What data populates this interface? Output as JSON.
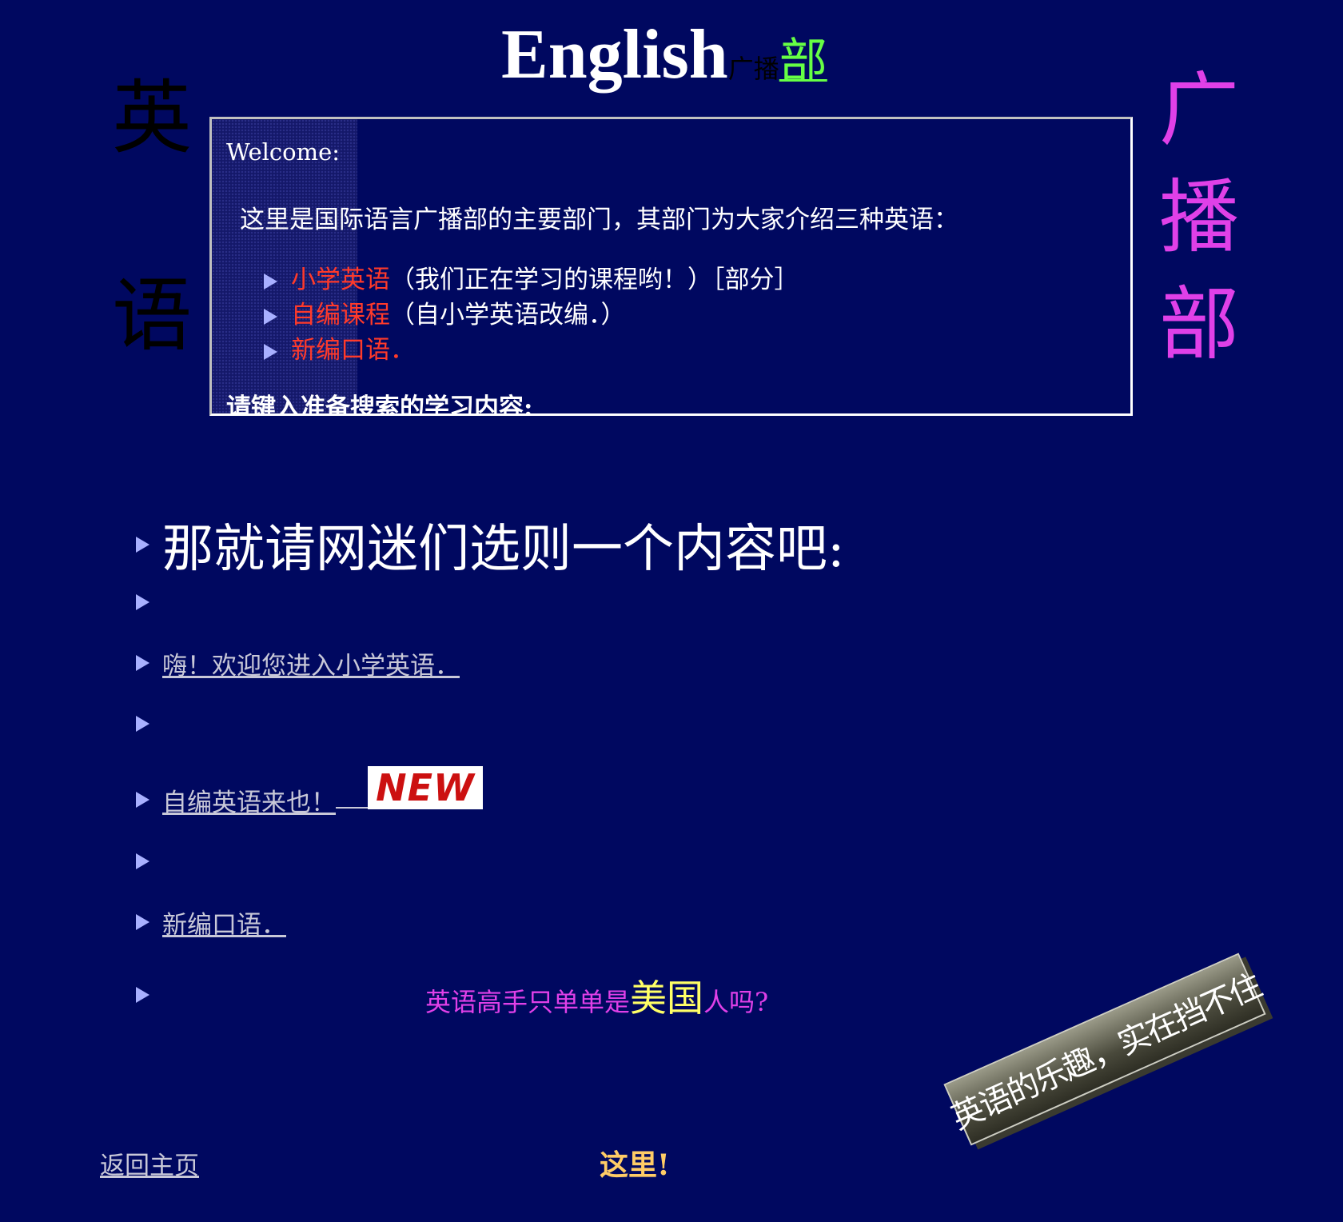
{
  "header": {
    "title_english": "English",
    "title_broadcast": "广播",
    "title_department": "部"
  },
  "side_left": [
    "英",
    "语"
  ],
  "side_right": [
    "广",
    "播",
    "部"
  ],
  "welcome_box": {
    "heading": "Welcome:",
    "intro": "这里是国际语言广播部的主要部门，其部门为大家介绍三种英语：",
    "items": [
      {
        "red": "小学英语",
        "white": "（我们正在学习的课程哟！）［部分］"
      },
      {
        "red": "自编课程",
        "white": "（自小学英语改编．）"
      },
      {
        "red": "新编口语．",
        "white": ""
      }
    ],
    "search_prompt": "请键入准备搜索的学习内容:"
  },
  "main": {
    "choose_heading": "那就请网迷们选则一个内容吧:",
    "link_primary": "嗨！欢迎您进入小学英语．",
    "link_self_made": "自编英语来也！",
    "new_badge": "NEW",
    "link_oral": "新编口语．",
    "question_part1": "英语高手只单单是",
    "question_big": "美国",
    "question_part2": "人吗?"
  },
  "banner": {
    "text": "英语的乐趣，实在挡不住"
  },
  "footer": {
    "home_link": "返回主页",
    "here": "这里!"
  },
  "colors": {
    "background": "#000860",
    "bullet": "#a8b0ff",
    "item_red": "#ff3a2a",
    "side_right": "#e040e8",
    "department_green": "#66ff44",
    "question_yellow": "#ffff66",
    "here_orange": "#ffcc66"
  }
}
